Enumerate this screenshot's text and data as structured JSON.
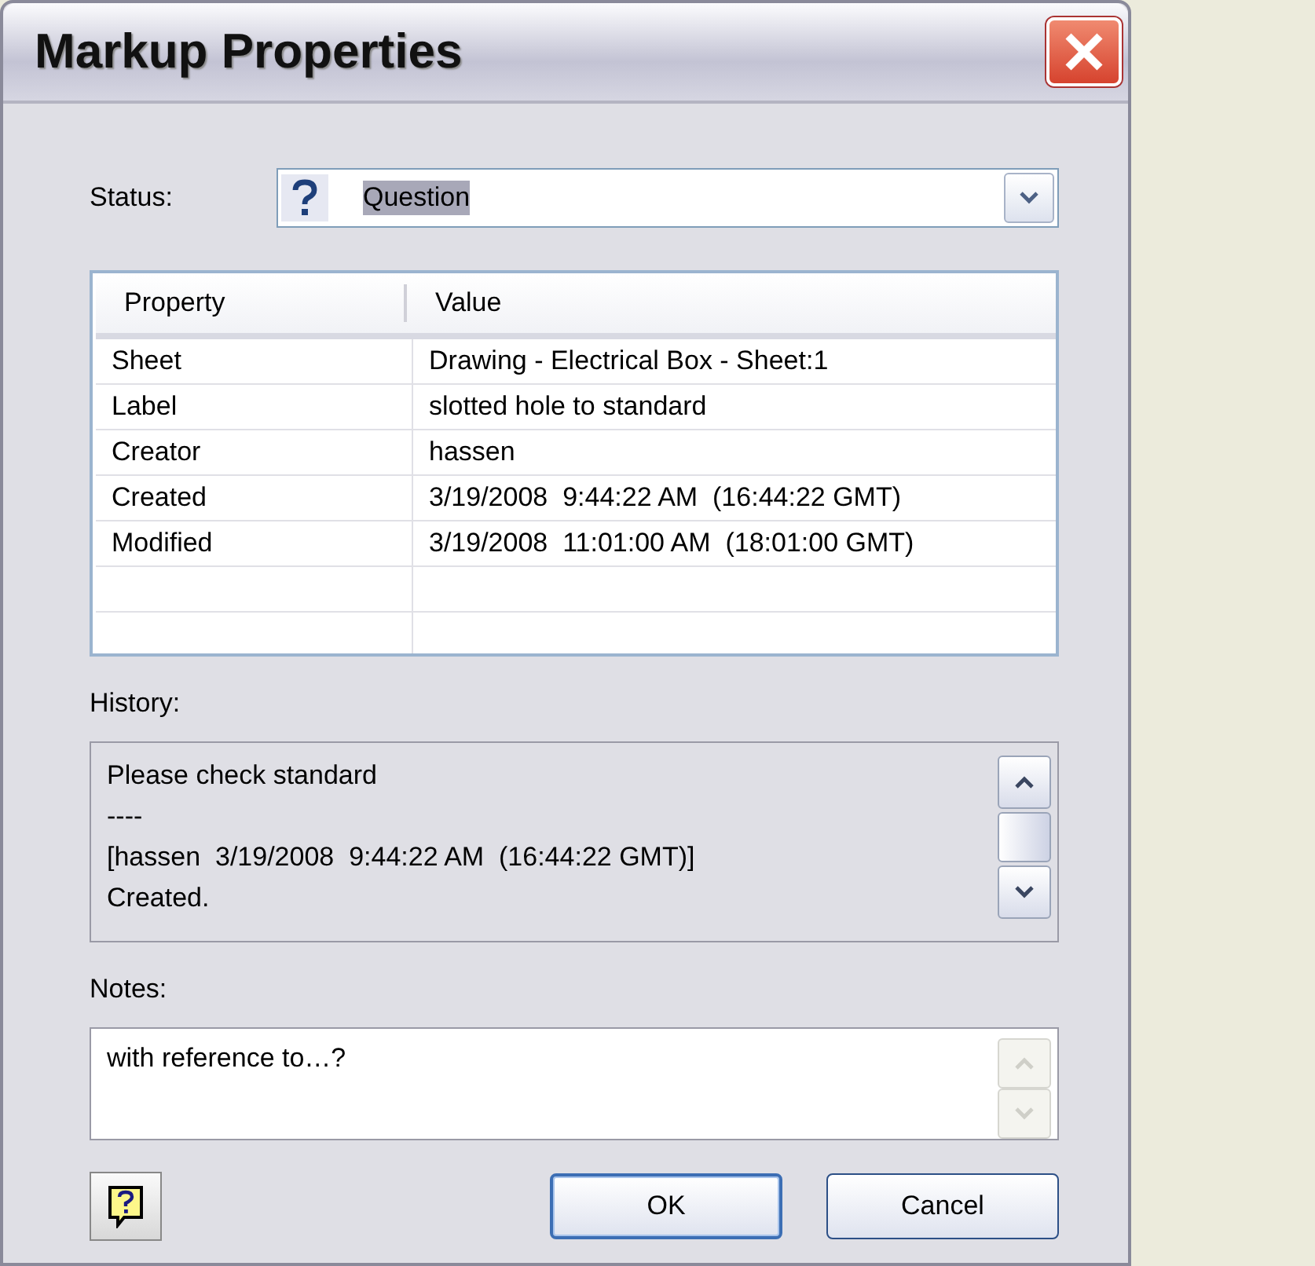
{
  "window": {
    "title": "Markup Properties"
  },
  "status": {
    "label": "Status:",
    "value": "Question",
    "text_selected": true
  },
  "properties_table": {
    "columns": [
      "Property",
      "Value"
    ],
    "rows": [
      [
        "Sheet",
        "Drawing - Electrical Box - Sheet:1"
      ],
      [
        "Label",
        "slotted hole to standard"
      ],
      [
        "Creator",
        "hassen"
      ],
      [
        "Created",
        "3/19/2008  9:44:22 AM  (16:44:22 GMT)"
      ],
      [
        "Modified",
        "3/19/2008  11:01:00 AM  (18:01:00 GMT)"
      ]
    ]
  },
  "history": {
    "label": "History:",
    "read_only": true,
    "lines": [
      "Please check standard",
      "----",
      "[hassen  3/19/2008  9:44:22 AM  (16:44:22 GMT)]",
      "Created."
    ]
  },
  "notes": {
    "label": "Notes:",
    "value": "with reference to…?"
  },
  "buttons": [
    {
      "label": "OK",
      "default": true
    },
    {
      "label": "Cancel",
      "default": false
    }
  ]
}
